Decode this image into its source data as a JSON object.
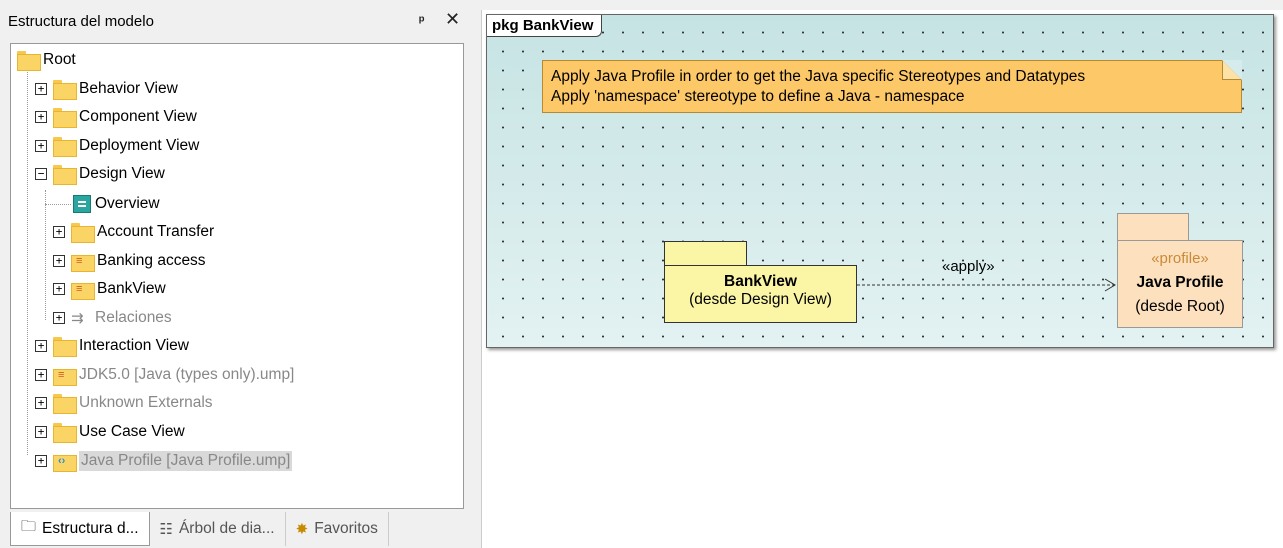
{
  "panel": {
    "title": "Estructura del modelo",
    "pin_glyph": "📌",
    "close_glyph": "✕"
  },
  "tree": {
    "root": "Root",
    "items": [
      {
        "label": "Behavior View",
        "icon": "folder-icon"
      },
      {
        "label": "Component View",
        "icon": "folder-icon"
      },
      {
        "label": "Deployment View",
        "icon": "folder-icon"
      },
      {
        "label": "Design View",
        "icon": "folder-icon",
        "expanded": true
      },
      {
        "label": "Overview",
        "icon": "diagram-icon"
      },
      {
        "label": "Account Transfer",
        "icon": "folder-icon"
      },
      {
        "label": "Banking access",
        "icon": "java-package-icon"
      },
      {
        "label": "BankView",
        "icon": "java-package-icon"
      },
      {
        "label": "Relaciones",
        "icon": "relations-icon"
      },
      {
        "label": "Interaction View",
        "icon": "folder-icon"
      },
      {
        "label": "JDK5.0 [Java (types only).ump]",
        "icon": "java-package-icon"
      },
      {
        "label": "Unknown Externals",
        "icon": "folder-icon"
      },
      {
        "label": "Use Case View",
        "icon": "folder-icon"
      },
      {
        "label": "Java Profile [Java Profile.ump]",
        "icon": "profile-package-icon"
      }
    ]
  },
  "tabs": [
    {
      "label": "Estructura d...",
      "icon": "folder-icon",
      "active": true
    },
    {
      "label": "Árbol de dia...",
      "icon": "diagram-tree-icon"
    },
    {
      "label": "Favoritos",
      "icon": "star-icon"
    }
  ],
  "diagram": {
    "frame_label": "pkg BankView",
    "note_line1": "Apply Java Profile in order to get the Java specific Stereotypes and Datatypes",
    "note_line2": "Apply 'namespace' stereotype to define a Java - namespace",
    "bankview": {
      "name": "BankView",
      "origin": "(desde Design View)"
    },
    "profile": {
      "stereotype": "«profile»",
      "name": "Java Profile",
      "origin": "(desde Root)"
    },
    "dependency_label": "«apply»"
  },
  "colors": {
    "note": "#fdc868",
    "package": "#fbf5a6",
    "profile": "#fde1bf",
    "frame": "#d6ecec"
  }
}
